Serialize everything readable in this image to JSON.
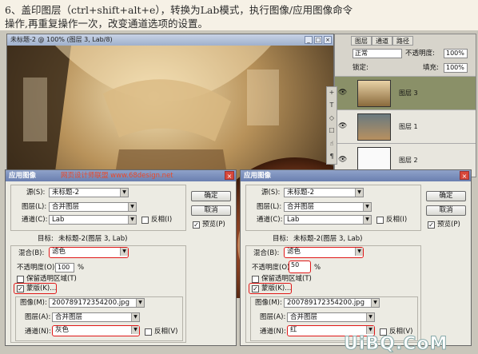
{
  "caption": {
    "line1": "6、盖印图层（ctrl+shift+alt+e），转换为Lab模式，执行图像/应用图像命令",
    "line2": "操作,再重复操作一次，改变通道选项的设置。"
  },
  "document": {
    "title": "未标题-2 @ 100% (图层 3, Lab/8)",
    "buttons": [
      "_",
      "□",
      "×"
    ]
  },
  "layers_panel": {
    "tabs": [
      "图层",
      "通道",
      "路径"
    ],
    "blend_mode": "正常",
    "opacity_label": "不透明度:",
    "opacity_value": "100%",
    "lock_label": "锁定:",
    "fill_label": "填充:",
    "fill_value": "100%",
    "layers": [
      {
        "name": "图层 3",
        "selected": true
      },
      {
        "name": "图层 1",
        "selected": false
      },
      {
        "name": "图层 2",
        "selected": false
      }
    ]
  },
  "tools": [
    "+",
    "T",
    "◇",
    "☐",
    "☝",
    "¶"
  ],
  "dialog_left": {
    "title": "应用图像",
    "overlay_text": "网页设计师联盟 www.68design.net",
    "source_label": "源(S):",
    "source_value": "未标题-2",
    "layer_label": "图层(L):",
    "layer_value": "合并图层",
    "channel_label": "通道(C):",
    "channel_value": "Lab",
    "invert_label": "反相(I)",
    "ok": "确定",
    "cancel": "取消",
    "preview": "预览(P)",
    "target_label": "目标:",
    "target_value": "未标题-2(图层 3, Lab)",
    "blend_label": "混合(B):",
    "blend_value": "滤色",
    "opacity_label": "不透明度(O):",
    "opacity_value": "100",
    "percent": "%",
    "preserve": "保留透明区域(T)",
    "mask": "蒙版(K)...",
    "image_label": "图像(M):",
    "image_value": "200789172354200.jpg",
    "mask_layer_label": "图层(A):",
    "mask_layer_value": "合并图层",
    "mask_channel_label": "通道(N):",
    "mask_channel_value": "灰色",
    "mask_invert": "反相(V)"
  },
  "dialog_right": {
    "title": "应用图像",
    "source_label": "源(S):",
    "source_value": "未标题-2",
    "layer_label": "图层(L):",
    "layer_value": "合并图层",
    "channel_label": "通道(C):",
    "channel_value": "Lab",
    "invert_label": "反相(I)",
    "ok": "确定",
    "cancel": "取消",
    "preview": "预览(P)",
    "target_label": "目标:",
    "target_value": "未标题-2(图层 3, Lab)",
    "blend_label": "混合(B):",
    "blend_value": "滤色",
    "opacity_label": "不透明度(O):",
    "opacity_value": "50",
    "percent": "%",
    "preserve": "保留透明区域(T)",
    "mask": "蒙版(K)...",
    "image_label": "图像(M):",
    "image_value": "200789172354200.jpg",
    "mask_layer_label": "图层(A):",
    "mask_layer_value": "合并图层",
    "mask_channel_label": "通道(N):",
    "mask_channel_value": "红",
    "mask_invert": "反相(V)"
  },
  "watermark": "UiBQ.CoM",
  "colors": {
    "highlight": "#e01818",
    "title_bar": "#6a7fb0",
    "layer_selected": "#8a9068"
  }
}
